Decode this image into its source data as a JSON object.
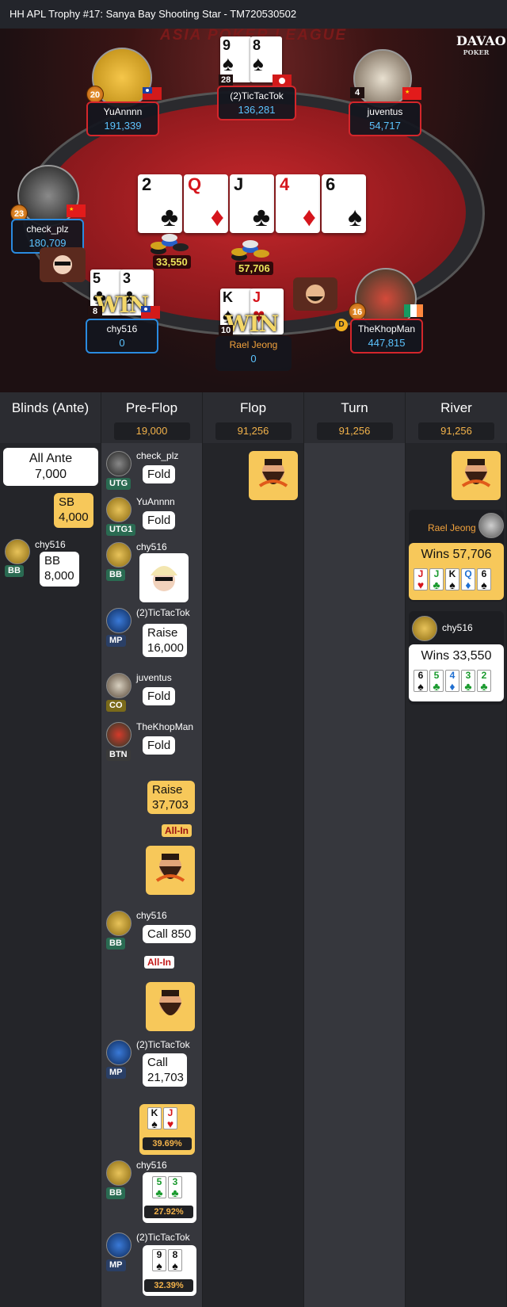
{
  "title": "HH  APL Trophy #17: Sanya Bay Shooting Star    - TM720530502",
  "table": {
    "banner": "ASIA POKER LEAGUE",
    "logo_top": "DAVAO",
    "logo_bottom": "POKER",
    "board": [
      {
        "rank": "2",
        "suit": "♣",
        "color": "black"
      },
      {
        "rank": "Q",
        "suit": "♦",
        "color": "red"
      },
      {
        "rank": "J",
        "suit": "♣",
        "color": "black"
      },
      {
        "rank": "4",
        "suit": "♦",
        "color": "red"
      },
      {
        "rank": "6",
        "suit": "♠",
        "color": "black"
      }
    ],
    "pots": [
      "33,550",
      "57,706"
    ],
    "win_label": "WIN",
    "dealer_label": "D",
    "seats": {
      "yuannnn": {
        "name": "YuAnnnn",
        "stack": "191,339",
        "level": "20"
      },
      "tictactok": {
        "name": "(2)TicTacTok",
        "stack": "136,281",
        "level": "28",
        "cards": [
          {
            "rank": "9",
            "suit": "♠"
          },
          {
            "rank": "8",
            "suit": "♠"
          }
        ]
      },
      "juventus": {
        "name": "juventus",
        "stack": "54,717",
        "level": "4"
      },
      "check_plz": {
        "name": "check_plz",
        "stack": "180,709",
        "level": "23"
      },
      "chy516": {
        "name": "chy516",
        "stack": "0",
        "level": "8",
        "cards": [
          {
            "rank": "5",
            "suit": "♣"
          },
          {
            "rank": "3",
            "suit": "♣"
          }
        ]
      },
      "rael": {
        "name": "Rael Jeong",
        "stack": "0",
        "level": "10",
        "cards": [
          {
            "rank": "K",
            "suit": "♠",
            "color": "black"
          },
          {
            "rank": "J",
            "suit": "♥",
            "color": "red"
          }
        ]
      },
      "khopman": {
        "name": "TheKhopMan",
        "stack": "447,815",
        "level": "16"
      }
    }
  },
  "streets": {
    "blinds": {
      "label": "Blinds (Ante)"
    },
    "preflop": {
      "label": "Pre-Flop",
      "pot": "19,000"
    },
    "flop": {
      "label": "Flop",
      "pot": "91,256"
    },
    "turn": {
      "label": "Turn",
      "pot": "91,256"
    },
    "river": {
      "label": "River",
      "pot": "91,256"
    }
  },
  "blinds_actions": {
    "ante": "All Ante\n7,000",
    "ante_l1": "All Ante",
    "ante_l2": "7,000",
    "sb_l1": "SB",
    "sb_l2": "4,000",
    "bb_player": "chy516",
    "bb_pos": "BB",
    "bb_l1": "BB",
    "bb_l2": "8,000"
  },
  "preflop_actions": [
    {
      "player": "check_plz",
      "pos": "UTG",
      "action": "Fold"
    },
    {
      "player": "YuAnnnn",
      "pos": "UTG1",
      "action": "Fold"
    },
    {
      "player": "chy516",
      "pos": "BB"
    },
    {
      "player": "(2)TicTacTok",
      "pos": "MP",
      "action_l1": "Raise",
      "action_l2": "16,000"
    },
    {
      "player": "juventus",
      "pos": "CO",
      "action": "Fold"
    },
    {
      "player": "TheKhopMan",
      "pos": "BTN",
      "action": "Fold"
    },
    {
      "hero_l1": "Raise",
      "hero_l2": "37,703",
      "allin": "All-In"
    },
    {
      "player": "chy516",
      "pos": "BB",
      "action": "Call  850",
      "allin": "All-In"
    },
    {
      "player": "(2)TicTacTok",
      "pos": "MP",
      "action_l1": "Call",
      "action_l2": "21,703"
    },
    {
      "hero_equity": "39.69%"
    },
    {
      "player": "chy516",
      "pos": "BB",
      "equity": "27.92%"
    },
    {
      "player": "(2)TicTacTok",
      "pos": "MP",
      "equity": "32.39%"
    }
  ],
  "hero_cards": [
    {
      "rank": "K",
      "suit": "♠",
      "color": "black"
    },
    {
      "rank": "J",
      "suit": "♥",
      "color": "red"
    }
  ],
  "chy_cards": [
    {
      "rank": "5",
      "suit": "♣",
      "color": "green"
    },
    {
      "rank": "3",
      "suit": "♣",
      "color": "green"
    }
  ],
  "ttt_cards": [
    {
      "rank": "9",
      "suit": "♠",
      "color": "black"
    },
    {
      "rank": "8",
      "suit": "♠",
      "color": "black"
    }
  ],
  "river_results": [
    {
      "player": "Rael Jeong",
      "wins": "Wins 57,706",
      "cards": [
        {
          "rank": "J",
          "suit": "♥",
          "color": "red"
        },
        {
          "rank": "J",
          "suit": "♣",
          "color": "green"
        },
        {
          "rank": "K",
          "suit": "♠",
          "color": "black"
        },
        {
          "rank": "Q",
          "suit": "♦",
          "color": "blue"
        },
        {
          "rank": "6",
          "suit": "♠",
          "color": "black"
        }
      ]
    },
    {
      "player": "chy516",
      "wins": "Wins 33,550",
      "cards": [
        {
          "rank": "6",
          "suit": "♠",
          "color": "black"
        },
        {
          "rank": "5",
          "suit": "♣",
          "color": "green"
        },
        {
          "rank": "4",
          "suit": "♦",
          "color": "blue"
        },
        {
          "rank": "3",
          "suit": "♣",
          "color": "green"
        },
        {
          "rank": "2",
          "suit": "♣",
          "color": "green"
        }
      ]
    }
  ],
  "colors": {
    "accent": "#f2b24a",
    "stack": "#5cc4ff",
    "bubble_yellow": "#f7c85a",
    "felt": "#c8282c"
  }
}
